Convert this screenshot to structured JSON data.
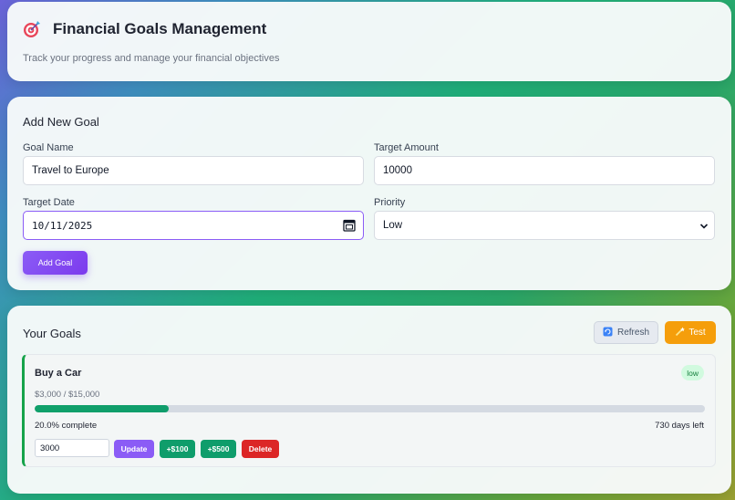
{
  "header": {
    "icon": "target-icon",
    "title": "Financial Goals Management",
    "subtitle": "Track your progress and manage your financial objectives"
  },
  "add_goal": {
    "section_title": "Add New Goal",
    "goal_name_label": "Goal Name",
    "goal_name_value": "Travel to Europe",
    "target_amount_label": "Target Amount",
    "target_amount_value": "10000",
    "target_date_label": "Target Date",
    "target_date_value": "10/11/2025",
    "priority_label": "Priority",
    "priority_value": "Low",
    "submit_label": "Add Goal"
  },
  "goals": {
    "section_title": "Your Goals",
    "refresh_label": "Refresh",
    "test_label": "Test",
    "items": [
      {
        "name": "Buy a Car",
        "priority": "low",
        "amount_text": "$3,000 / $15,000",
        "progress_fraction": 0.2,
        "percent_text": "20.0% complete",
        "days_left_text": "730 days left",
        "update_value": "3000",
        "update_label": "Update",
        "add100_label": "+$100",
        "add500_label": "+$500",
        "delete_label": "Delete"
      }
    ]
  },
  "colors": {
    "accent": "#8b5cf6",
    "success": "#0f9d6b",
    "warning": "#f59e0b",
    "danger": "#dc2626"
  }
}
